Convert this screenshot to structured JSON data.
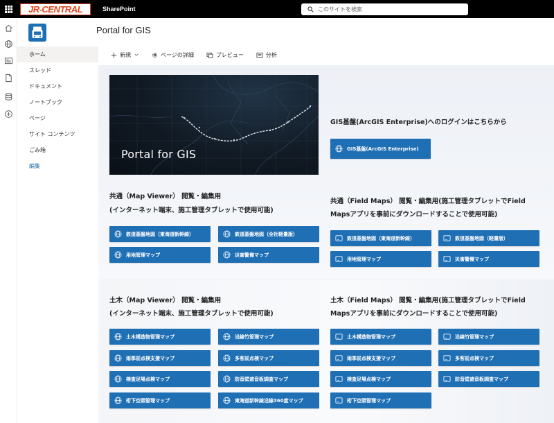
{
  "suitebar": {
    "brand_logo_text": "JR-CENTRAL",
    "app_name": "SharePoint",
    "search_placeholder": "このサイトを検索"
  },
  "appbar": {
    "icons": [
      "home-icon",
      "globe-icon",
      "news-icon",
      "document-icon",
      "database-icon",
      "add-icon"
    ]
  },
  "site": {
    "title": "Portal for GIS"
  },
  "leftnav": {
    "items": [
      {
        "label": "ホーム",
        "active": true
      },
      {
        "label": "スレッド"
      },
      {
        "label": "ドキュメント"
      },
      {
        "label": "ノートブック"
      },
      {
        "label": "ページ"
      },
      {
        "label": "サイト コンテンツ"
      },
      {
        "label": "ごみ箱"
      },
      {
        "label": "編集",
        "link": true
      }
    ]
  },
  "commandbar": {
    "new": "新規",
    "page_details": "ページの詳細",
    "preview": "プレビュー",
    "analytics": "分析"
  },
  "hero": {
    "title": "Portal for GIS"
  },
  "login": {
    "heading": "GIS基盤(ArcGIS Enterprise)へのログインはこちらから",
    "button": "GIS基盤(ArcGIS Enterprise)"
  },
  "common_map_viewer": {
    "heading_line1": "共通（Map Viewer） 閲覧・編集用",
    "heading_line2": "(インターネット端末、施工管理タブレットで使用可能)",
    "buttons": [
      "鉄道基盤地図（東海道新幹線）",
      "鉄道基盤地図（全社軽量版）",
      "用地管理マップ",
      "災害警備マップ"
    ]
  },
  "common_field_maps": {
    "heading_line1": "共通（Field Maps） 閲覧・編集用(施工管理タブレットでField",
    "heading_line2": "Mapsアプリを事前にダウンロードすることで使用可能)",
    "buttons": [
      "鉄道基盤地図（東海道新幹線）",
      "鉄道基盤地図（軽量版）",
      "用地管理マップ",
      "災害警備マップ"
    ]
  },
  "civil_map_viewer": {
    "heading_line1": "土木（Map Viewer） 閲覧・編集用",
    "heading_line2": "(インターネット端末、施工管理タブレットで使用可能)",
    "buttons": [
      "土木構造物管理マップ",
      "沿線竹管理マップ",
      "雨季前点検支援マップ",
      "多客前点検マップ",
      "検査足場点検マップ",
      "防音壁遮音板調査マップ",
      "桁下空頭管理マップ",
      "東海道新幹線沿線360度マップ"
    ]
  },
  "civil_field_maps": {
    "heading_line1": "土木（Field Maps） 閲覧・編集用(施工管理タブレットでField",
    "heading_line2": "Mapsアプリを事前にダウンロードすることで使用可能)",
    "buttons": [
      "土木構造物管理マップ",
      "沿線竹管理マップ",
      "雨季前点検支援マップ",
      "多客前点検マップ",
      "検査足場点検マップ",
      "防音壁遮音板調査マップ",
      "桁下空頭管理マップ"
    ]
  },
  "colors": {
    "brand_orange": "#e2431e",
    "button_blue": "#1f6fb5",
    "link_blue": "#1a6aa8",
    "suitebar_black": "#000000"
  }
}
